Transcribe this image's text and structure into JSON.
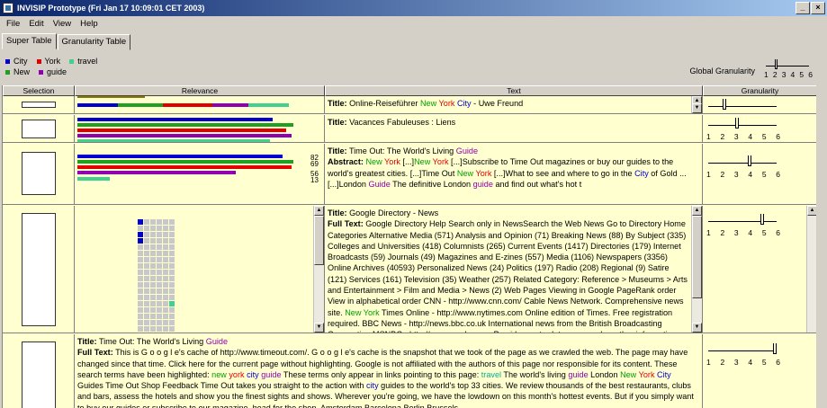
{
  "window": {
    "title": "INVISIP Prototype (Fri Jan 17 10:09:01 CET 2003)",
    "buttons": [
      "_",
      "×"
    ]
  },
  "menu": [
    "File",
    "Edit",
    "View",
    "Help"
  ],
  "tabs": [
    {
      "label": "Super Table",
      "active": false
    },
    {
      "label": "Granularity Table",
      "active": true
    }
  ],
  "legend": [
    {
      "label": "City",
      "color": "#0000d0"
    },
    {
      "label": "York",
      "color": "#e00000"
    },
    {
      "label": "travel",
      "color": "#40d090"
    },
    {
      "label": "New",
      "color": "#20a020"
    },
    {
      "label": "guide",
      "color": "#9000b0"
    }
  ],
  "global_granularity": {
    "label": "Global Granularity",
    "ticks": [
      "1",
      "2",
      "3",
      "4",
      "5",
      "6"
    ],
    "value": 2
  },
  "columns": [
    "Selection",
    "Relevance",
    "Text",
    "Granularity"
  ],
  "rows": [
    {
      "title_label": "Title:",
      "title_parts": [
        {
          "t": "Online-Reiseführer ",
          "c": ""
        },
        {
          "t": "New",
          "c": "kw-green"
        },
        {
          "t": " ",
          "c": ""
        },
        {
          "t": "York",
          "c": "kw-red"
        },
        {
          "t": " ",
          "c": ""
        },
        {
          "t": "City",
          "c": "kw-blue"
        },
        {
          "t": " - Uwe Freund",
          "c": ""
        }
      ],
      "granularity": 2,
      "granularity_ticks": [
        "1",
        "2",
        "3",
        "4",
        "5",
        "6"
      ]
    },
    {
      "title_label": "Title:",
      "title_parts": [
        {
          "t": "Vacances Fabuleuses : Liens",
          "c": ""
        }
      ],
      "granularity": 3,
      "granularity_ticks": [
        "1",
        "2",
        "3",
        "4",
        "5",
        "6"
      ]
    },
    {
      "title_label": "Title:",
      "title_parts": [
        {
          "t": "Time Out: The World's Living ",
          "c": ""
        },
        {
          "t": "Guide",
          "c": "kw-purple"
        }
      ],
      "body_label": "Abstract:",
      "body_parts": [
        {
          "t": "New",
          "c": "kw-green"
        },
        {
          "t": " ",
          "c": ""
        },
        {
          "t": "York",
          "c": "kw-red"
        },
        {
          "t": " [...]",
          "c": ""
        },
        {
          "t": "New",
          "c": "kw-green"
        },
        {
          "t": " ",
          "c": ""
        },
        {
          "t": "York",
          "c": "kw-red"
        },
        {
          "t": " [...]Subscribe to Time Out magazines or buy our guides to the world's greatest cities. [...]Time Out ",
          "c": ""
        },
        {
          "t": "New",
          "c": "kw-green"
        },
        {
          "t": " ",
          "c": ""
        },
        {
          "t": "York",
          "c": "kw-red"
        },
        {
          "t": " [...]What to see and where to go in the ",
          "c": ""
        },
        {
          "t": "City",
          "c": "kw-blue"
        },
        {
          "t": " of Gold ... [...]London ",
          "c": ""
        },
        {
          "t": "Guide",
          "c": "kw-purple"
        },
        {
          "t": " The definitive London ",
          "c": ""
        },
        {
          "t": "guide",
          "c": "kw-purple"
        },
        {
          "t": " and find out what's hot t",
          "c": ""
        }
      ],
      "rel_numbers": [
        "82",
        "69",
        "56",
        "13"
      ],
      "granularity": 4,
      "granularity_ticks": [
        "1",
        "2",
        "3",
        "4",
        "5",
        "6"
      ]
    },
    {
      "title_label": "Title:",
      "title_parts": [
        {
          "t": "Google Directory - News",
          "c": ""
        }
      ],
      "body_label": "Full Text:",
      "body_parts": [
        {
          "t": "Google Directory Help Search only in NewsSearch the Web News Go to Directory Home Categories Alternative Media (571) Analysis and Opinion (71) Breaking News (88) By Subject (335) Colleges and Universities (418) Columnists (265) Current Events (1417) Directories (179) Internet Broadcasts (59) Journals (49) Magazines and E-zines (557) Media (1106) Newspapers (3356) Online Archives (40593) Personalized News (24) Politics (197) Radio (208) Regional (9) Satire (121) Services (161) Television (35) Weather (257) Related Category: Reference > Museums > Arts and Entertainment > Film and Media > News (2) Web Pages Viewing in Google PageRank order View in alphabetical order CNN - http://www.cnn.com/ Cable News Network. Comprehensive news site. ",
          "c": ""
        },
        {
          "t": "New York",
          "c": "kw-green"
        },
        {
          "t": " Times Online - http://www.nytimes.com Online edition of Times. Free registration required. BBC News - http://news.bbc.co.uk International news from the British Broadcasting Corporation MSNBC - http://www.msnbc.com Provides up-to-date news and weather information from around the country. Yahoo! News - http://",
          "c": ""
        }
      ],
      "granularity": 5,
      "granularity_ticks": [
        "1",
        "2",
        "3",
        "4",
        "5",
        "6"
      ]
    },
    {
      "title_label": "Title:",
      "title_parts": [
        {
          "t": "Time Out: The World's Living ",
          "c": ""
        },
        {
          "t": "Guide",
          "c": "kw-purple"
        }
      ],
      "body_label": "Full Text:",
      "body_parts": [
        {
          "t": "This is G o o g l e's cache of http://www.timeout.com/. G o o g l e's cache is the snapshot that we took of the page as we crawled the web. The page may have changed since that time. Click here for the current page without highlighting. Google is not affiliated with the authors of this page nor responsible for its content. These search terms have been highlighted: ",
          "c": ""
        },
        {
          "t": "new",
          "c": "kw-green"
        },
        {
          "t": " ",
          "c": ""
        },
        {
          "t": "york",
          "c": "kw-red"
        },
        {
          "t": " ",
          "c": ""
        },
        {
          "t": "city",
          "c": "kw-blue"
        },
        {
          "t": " ",
          "c": ""
        },
        {
          "t": "guide",
          "c": "kw-purple"
        },
        {
          "t": " These terms only appear in links pointing to this page: ",
          "c": ""
        },
        {
          "t": "travel",
          "c": "kw-teal"
        },
        {
          "t": " The world's living ",
          "c": ""
        },
        {
          "t": "guide",
          "c": "kw-purple"
        },
        {
          "t": " London ",
          "c": ""
        },
        {
          "t": "New",
          "c": "kw-green"
        },
        {
          "t": " ",
          "c": ""
        },
        {
          "t": "York",
          "c": "kw-red"
        },
        {
          "t": " ",
          "c": ""
        },
        {
          "t": "City",
          "c": "kw-blue"
        },
        {
          "t": " Guides Time Out Shop Feedback Time Out takes you straight to the action with ",
          "c": ""
        },
        {
          "t": "city",
          "c": "kw-blue"
        },
        {
          "t": " guides to the world's top 33 cities. We review thousands of the best restaurants, clubs and bars, assess the hotels and show you the finest sights and shows. Wherever you're going, we have the lowdown on this month's hottest events. But if you simply want to buy our guides or subscribe to our magazine, head for the shop. Amsterdam Barcelona Berlin Brussels",
          "c": ""
        }
      ],
      "granularity": 6,
      "granularity_ticks": [
        "1",
        "2",
        "3",
        "4",
        "5",
        "6"
      ]
    }
  ]
}
